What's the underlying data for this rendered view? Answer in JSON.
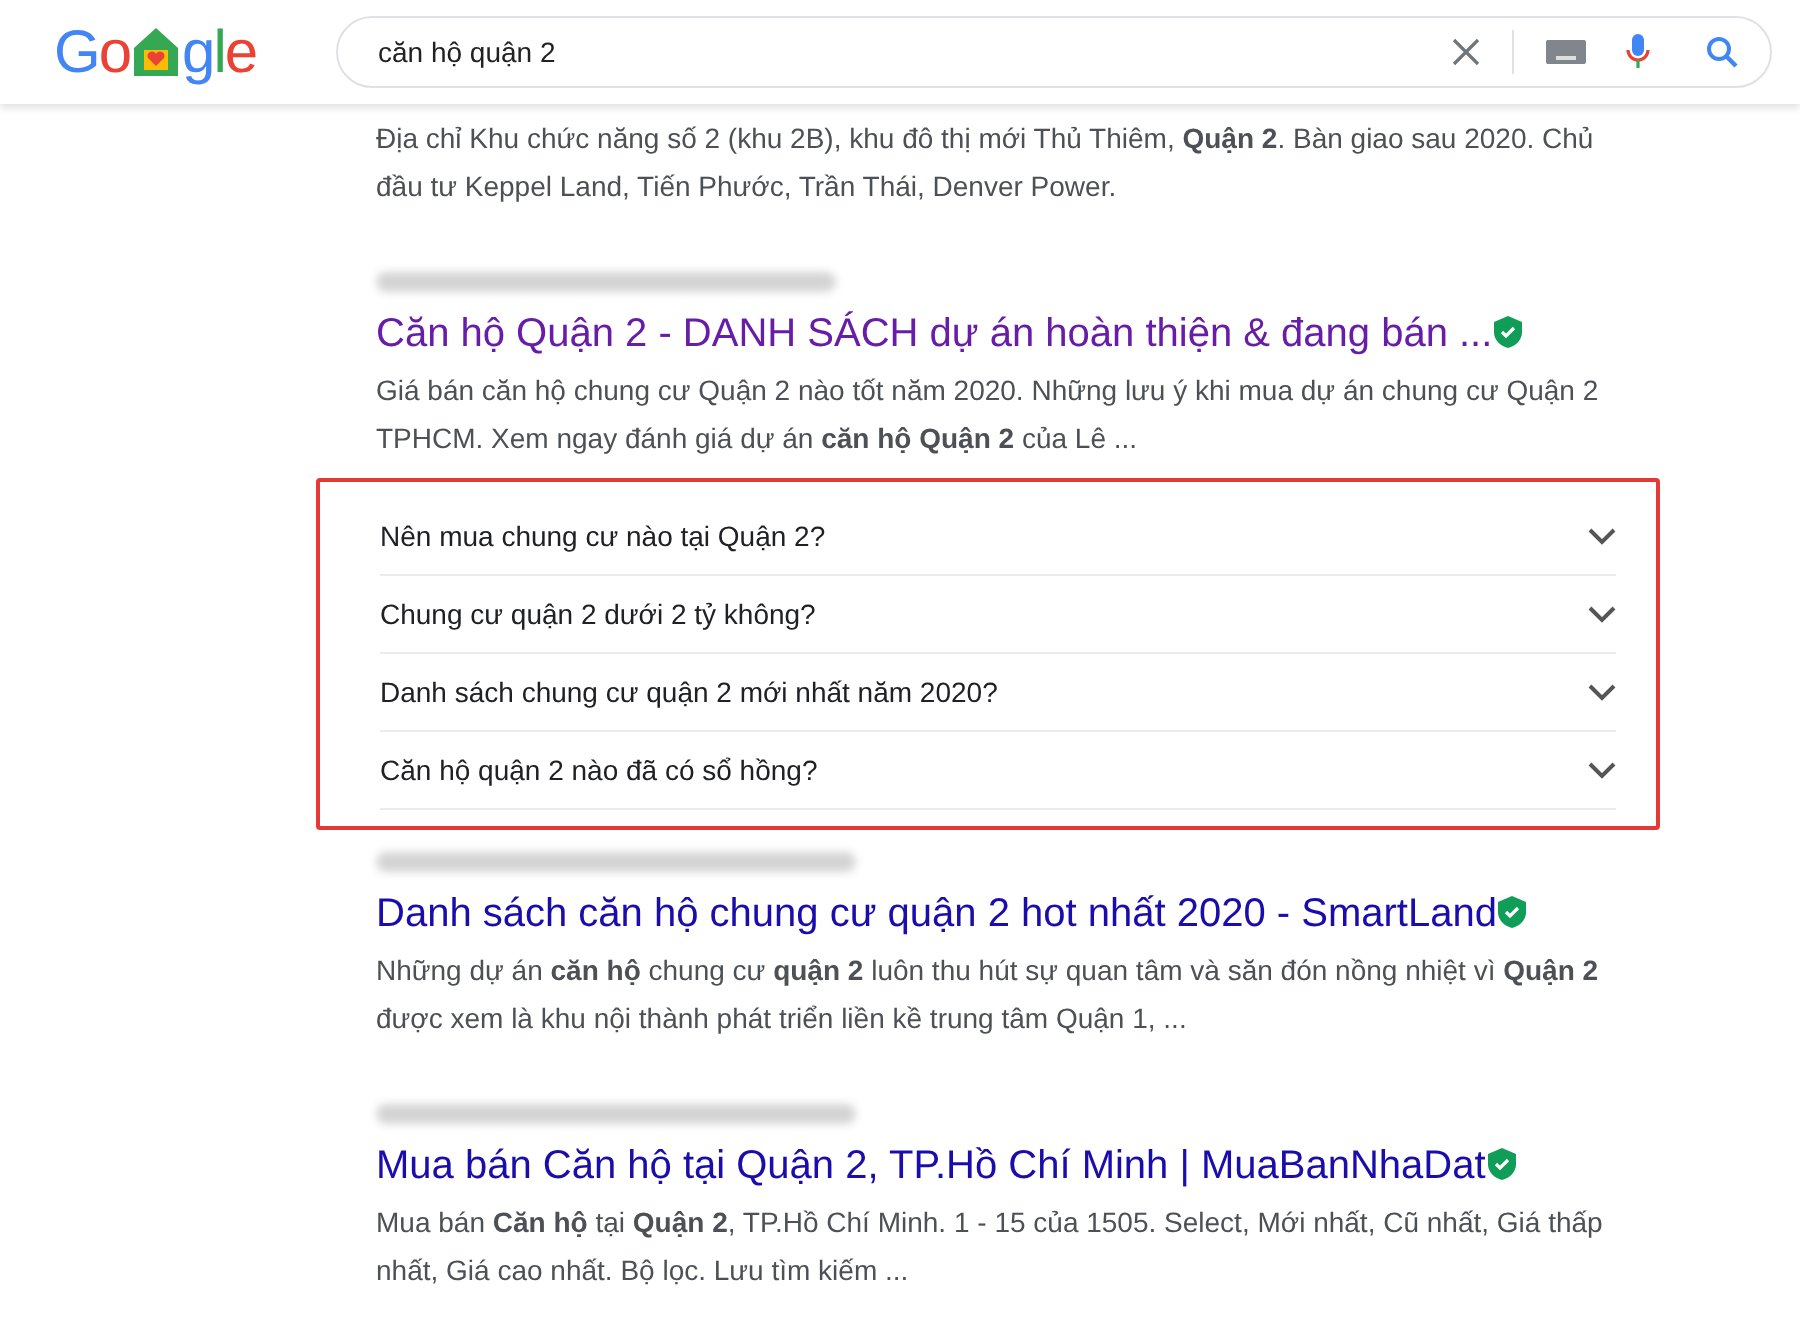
{
  "logo": {
    "before": "Go",
    "after": "gle"
  },
  "search": {
    "value": "căn hộ quận 2"
  },
  "top_snippet": "Địa chỉ Khu chức năng số 2 (khu 2B), khu đô thị mới Thủ Thiêm, **Quận 2**. Bàn giao sau 2020. Chủ đầu tư Keppel Land, Tiến Phước, Trần Thái, Denver Power.",
  "results": [
    {
      "kind": "result",
      "title": "Căn hộ Quận 2 - DANH SÁCH dự án hoàn thiện & đang bán ...",
      "visited": true,
      "verified": true,
      "snippet": "Giá bán căn hộ chung cư Quận 2 nào tốt năm 2020. Những lưu ý khi mua dự án chung cư Quận 2 TPHCM. Xem ngay đánh giá dự án **căn hộ Quận 2** của Lê ..."
    },
    {
      "kind": "questions",
      "highlighted": true,
      "items": [
        {
          "text": "Nên mua chung cư nào tại Quận 2?",
          "expanded": false
        },
        {
          "text": "Chung cư quận 2 dưới 2 tỷ không?",
          "expanded": false
        },
        {
          "text": "Danh sách chung cư quận 2 mới nhất năm 2020?",
          "expanded": false
        },
        {
          "text": "Căn hộ quận 2 nào đã có sổ hồng?",
          "expanded": false
        }
      ]
    },
    {
      "kind": "result",
      "title": "Danh sách căn hộ chung cư quận 2 hot nhất 2020 - SmartLand",
      "visited": false,
      "verified": true,
      "snippet": "Những dự án **căn hộ** chung cư **quận 2** luôn thu hút sự quan tâm và săn đón nồng nhiệt vì **Quận 2** được xem là khu nội thành phát triển liền kề trung tâm Quận 1, ..."
    },
    {
      "kind": "result",
      "title": "Mua bán Căn hộ tại Quận 2, TP.Hồ Chí Minh | MuaBanNhaDat",
      "visited": false,
      "verified": true,
      "snippet": "Mua bán **Căn hộ** tại **Quận 2**, TP.Hồ Chí Minh. 1 - 15 của 1505. Select, Mới nhất, Cũ nhất, Giá thấp nhất, Giá cao nhất. Bộ lọc. Lưu tìm kiếm ..."
    }
  ]
}
